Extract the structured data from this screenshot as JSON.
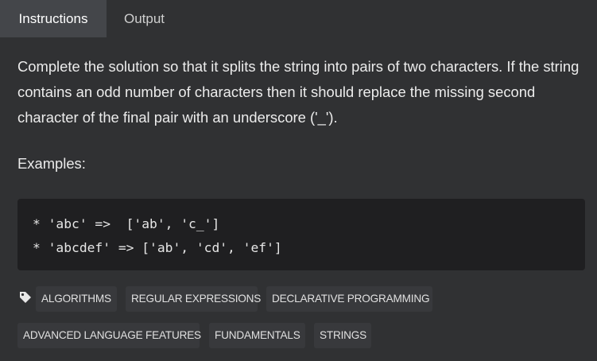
{
  "tabs": [
    {
      "label": "Instructions",
      "active": true
    },
    {
      "label": "Output",
      "active": false
    }
  ],
  "description": "Complete the solution so that it splits the string into pairs of two characters. If the string contains an odd number of characters then it should replace the missing second character of the final pair with an underscore ('_').",
  "examples_label": "Examples:",
  "code_lines": [
    "* 'abc' =>  ['ab', 'c_']",
    "* 'abcdef' => ['ab', 'cd', 'ef']"
  ],
  "tags_icon": "tag-icon",
  "tags": [
    "ALGORITHMS",
    "REGULAR EXPRESSIONS",
    "DECLARATIVE PROGRAMMING",
    "ADVANCED LANGUAGE FEATURES",
    "FUNDAMENTALS",
    "STRINGS"
  ],
  "colors": {
    "background": "#303133",
    "active_tab": "#44464a",
    "code_background": "#1f1f21",
    "tag_background": "#38393c"
  }
}
